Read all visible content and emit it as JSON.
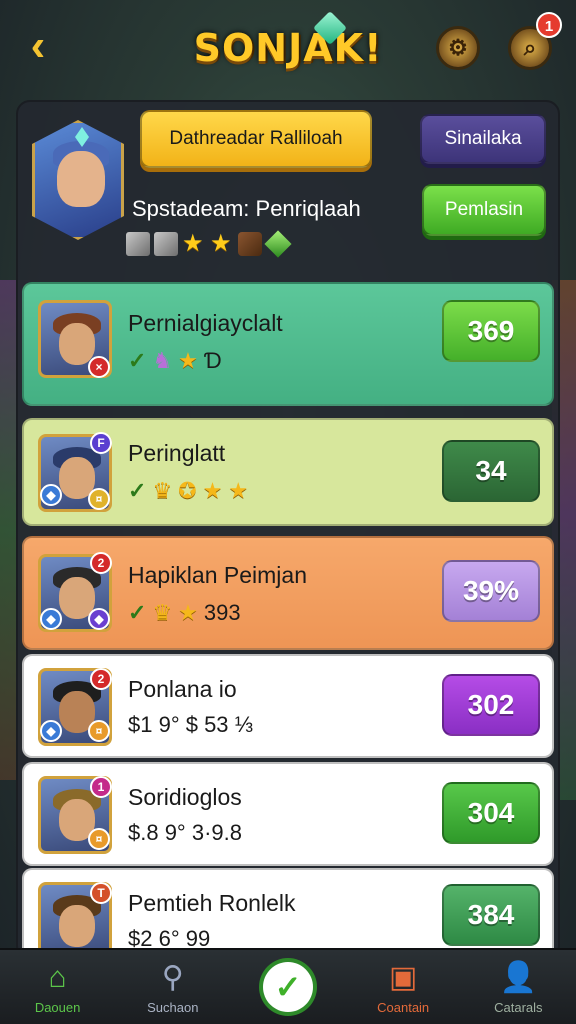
{
  "header": {
    "title": "SONJAK!",
    "back_icon": "chevron-left-icon",
    "settings_icon": "gear-icon",
    "search_icon": "magnifier-icon",
    "notification_count": "1"
  },
  "profile": {
    "primary_button": "Dathreadar Ralliloah",
    "secondary_button": "Sinailaka",
    "green_button": "Pemlasin",
    "player_name": "Spstadeam: Penriqlaah"
  },
  "rows": [
    {
      "name": "Pernialgiayclalt",
      "stats": "",
      "value": "369",
      "badge": "×"
    },
    {
      "name": "Peringlatt",
      "stats": "",
      "value": "34",
      "badge": "F"
    },
    {
      "name": "Hapiklan Peimjan",
      "stats": "393",
      "value": "39%",
      "badge": "2"
    },
    {
      "name": "Ponlana io",
      "stats": "$1 9° $ 53 ⅓",
      "value": "302",
      "badge": "2"
    },
    {
      "name": "Soridioglos",
      "stats": "$.8 9° 3·9.8",
      "value": "304",
      "badge": "1"
    },
    {
      "name": "Pemtieh Ronlelk",
      "stats": "$2 6° 99",
      "value": "384",
      "badge": "T"
    }
  ],
  "nav": [
    {
      "label": "Daouen",
      "icon": "home-icon"
    },
    {
      "label": "Suchaon",
      "icon": "search-icon"
    },
    {
      "label": "",
      "icon": "check-icon"
    },
    {
      "label": "Coantain",
      "icon": "chest-icon"
    },
    {
      "label": "Catarals",
      "icon": "person-icon"
    }
  ],
  "colors": {
    "title": "#ffc928",
    "nav_label_1": "#5cc64a",
    "nav_label_4": "#e36a3a"
  }
}
